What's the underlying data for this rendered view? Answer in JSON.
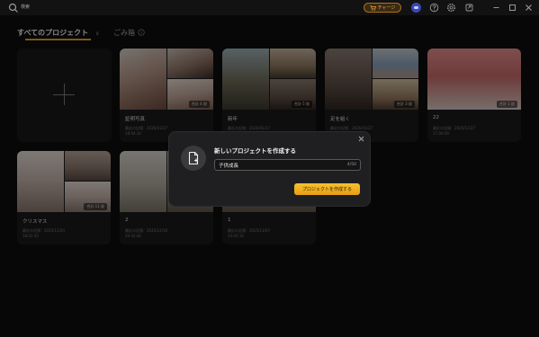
{
  "titlebar": {
    "search_text": "検索",
    "charge_label": "チャージ",
    "icons": [
      "search-icon",
      "cart-icon",
      "avatar",
      "help-icon",
      "settings-icon",
      "share-icon",
      "minimize-icon",
      "maximize-icon",
      "close-icon"
    ]
  },
  "tabs": {
    "all_label": "すべてのプロジェクト",
    "all_count": "8",
    "trash_label": "ごみ箱"
  },
  "projects": [
    {
      "title": "証明写真",
      "date": "最近の記憶：2026/01/27",
      "time": "18:04:34",
      "count": "合計 4 枚"
    },
    {
      "title": "新年",
      "date": "最近の記憶：2026/01/27",
      "time": "",
      "count": "合計 5 枚"
    },
    {
      "title": "足を組く",
      "date": "最近の記憶：2026/01/27",
      "time": "",
      "count": "合計 3 枚"
    },
    {
      "title": "22",
      "date": "最近の記憶：2025/12/27",
      "time": "17:09:09",
      "count": "合計 1 枚"
    },
    {
      "title": "クリスマス",
      "date": "最近の記憶：2025/12/24",
      "time": "18:02:45",
      "count": "合計 11 枚"
    },
    {
      "title": "2",
      "date": "最近の記憶：2025/12/18",
      "time": "20:42:46",
      "count": ""
    },
    {
      "title": "1",
      "date": "最近の記憶：2025/11/07",
      "time": "14:05:16",
      "count": ""
    }
  ],
  "modal": {
    "title": "新しいプロジェクトを作成する",
    "name_value": "子供成長",
    "counter": "4/50",
    "create_label": "プロジェクトを作成する"
  },
  "colors": {
    "accent": "#e8a228",
    "background": "#0d0d0e",
    "card": "#1b1b1d",
    "button": "#f2b022"
  }
}
